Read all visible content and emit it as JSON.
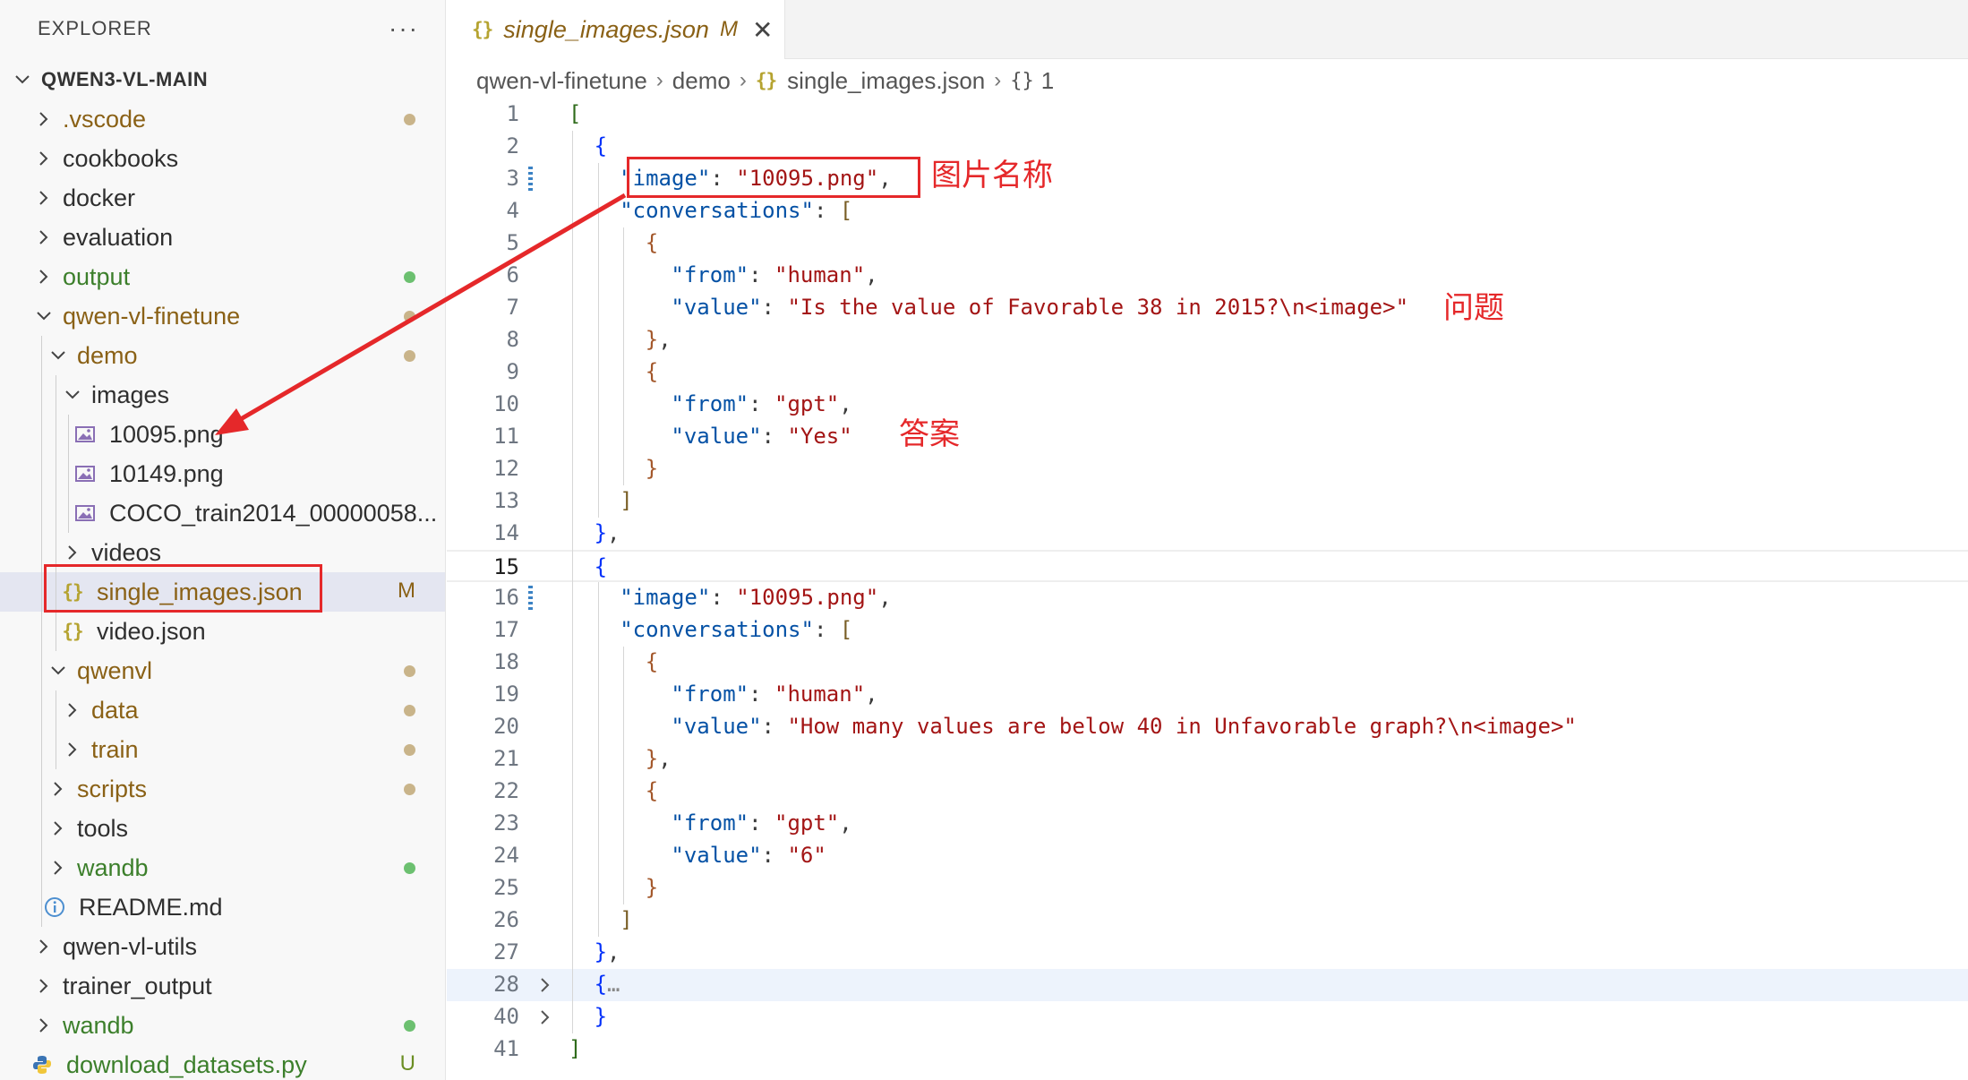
{
  "sidebar": {
    "title": "EXPLORER",
    "more": "···",
    "root": "QWEN3-VL-MAIN",
    "items": [
      {
        "label": ".vscode",
        "status": "dot"
      },
      {
        "label": "cookbooks"
      },
      {
        "label": "docker"
      },
      {
        "label": "evaluation"
      },
      {
        "label": "output",
        "status": "dot"
      },
      {
        "label": "qwen-vl-finetune",
        "status": "dot"
      },
      {
        "label": "demo",
        "status": "dot"
      },
      {
        "label": "images"
      },
      {
        "label": "10095.png"
      },
      {
        "label": "10149.png"
      },
      {
        "label": "COCO_train2014_00000058..."
      },
      {
        "label": "videos"
      },
      {
        "label": "single_images.json",
        "badge": "M"
      },
      {
        "label": "video.json"
      },
      {
        "label": "qwenvl",
        "status": "dot"
      },
      {
        "label": "data",
        "status": "dot"
      },
      {
        "label": "train",
        "status": "dot"
      },
      {
        "label": "scripts",
        "status": "dot"
      },
      {
        "label": "tools"
      },
      {
        "label": "wandb",
        "status": "dot"
      },
      {
        "label": "README.md"
      },
      {
        "label": "qwen-vl-utils"
      },
      {
        "label": "trainer_output"
      },
      {
        "label": "wandb",
        "status": "dot"
      },
      {
        "label": "download_datasets.py",
        "badge": "U"
      }
    ]
  },
  "tab": {
    "icon": "{}",
    "label": "single_images.json",
    "modified": "M",
    "close": "✕"
  },
  "breadcrumb": {
    "parts": [
      "qwen-vl-finetune",
      "demo",
      "single_images.json",
      "1"
    ],
    "json_icon": "{}",
    "object_icon": "{}"
  },
  "editor": {
    "line_numbers": [
      "1",
      "2",
      "3",
      "4",
      "5",
      "6",
      "7",
      "8",
      "9",
      "10",
      "11",
      "12",
      "13",
      "14",
      "15",
      "16",
      "17",
      "18",
      "19",
      "20",
      "21",
      "22",
      "23",
      "24",
      "25",
      "26",
      "27",
      "28",
      "40",
      "41"
    ],
    "current_line": "15",
    "lines": [
      [
        [
          "b1",
          "["
        ]
      ],
      [
        [
          "b2",
          "{"
        ]
      ],
      [
        [
          "key",
          "\"image\""
        ],
        [
          "punc",
          ": "
        ],
        [
          "str",
          "\"10095.png\""
        ],
        [
          "punc",
          ","
        ]
      ],
      [
        [
          "key",
          "\"conversations\""
        ],
        [
          "punc",
          ": "
        ],
        [
          "b3",
          "["
        ]
      ],
      [
        [
          "b4",
          "{"
        ]
      ],
      [
        [
          "key",
          "\"from\""
        ],
        [
          "punc",
          ": "
        ],
        [
          "str",
          "\"human\""
        ],
        [
          "punc",
          ","
        ]
      ],
      [
        [
          "key",
          "\"value\""
        ],
        [
          "punc",
          ": "
        ],
        [
          "str",
          "\"Is the value of Favorable 38 in 2015?\\n<image>\""
        ]
      ],
      [
        [
          "b4",
          "}"
        ],
        [
          "punc",
          ","
        ]
      ],
      [
        [
          "b4",
          "{"
        ]
      ],
      [
        [
          "key",
          "\"from\""
        ],
        [
          "punc",
          ": "
        ],
        [
          "str",
          "\"gpt\""
        ],
        [
          "punc",
          ","
        ]
      ],
      [
        [
          "key",
          "\"value\""
        ],
        [
          "punc",
          ": "
        ],
        [
          "str",
          "\"Yes\""
        ]
      ],
      [
        [
          "b4",
          "}"
        ]
      ],
      [
        [
          "b3",
          "]"
        ]
      ],
      [
        [
          "b2",
          "}"
        ],
        [
          "punc",
          ","
        ]
      ],
      [
        [
          "b2",
          "{"
        ]
      ],
      [
        [
          "key",
          "\"image\""
        ],
        [
          "punc",
          ": "
        ],
        [
          "str",
          "\"10095.png\""
        ],
        [
          "punc",
          ","
        ]
      ],
      [
        [
          "key",
          "\"conversations\""
        ],
        [
          "punc",
          ": "
        ],
        [
          "b3",
          "["
        ]
      ],
      [
        [
          "b4",
          "{"
        ]
      ],
      [
        [
          "key",
          "\"from\""
        ],
        [
          "punc",
          ": "
        ],
        [
          "str",
          "\"human\""
        ],
        [
          "punc",
          ","
        ]
      ],
      [
        [
          "key",
          "\"value\""
        ],
        [
          "punc",
          ": "
        ],
        [
          "str",
          "\"How many values are below 40 in Unfavorable graph?\\n<image>\""
        ]
      ],
      [
        [
          "b4",
          "}"
        ],
        [
          "punc",
          ","
        ]
      ],
      [
        [
          "b4",
          "{"
        ]
      ],
      [
        [
          "key",
          "\"from\""
        ],
        [
          "punc",
          ": "
        ],
        [
          "str",
          "\"gpt\""
        ],
        [
          "punc",
          ","
        ]
      ],
      [
        [
          "key",
          "\"value\""
        ],
        [
          "punc",
          ": "
        ],
        [
          "str",
          "\"6\""
        ]
      ],
      [
        [
          "b4",
          "}"
        ]
      ],
      [
        [
          "b3",
          "]"
        ]
      ],
      [
        [
          "b2",
          "}"
        ],
        [
          "punc",
          ","
        ]
      ],
      [
        [
          "b2",
          "{"
        ],
        [
          "fold",
          "…"
        ]
      ],
      [
        [
          "b2",
          "}"
        ]
      ],
      [
        [
          "b1",
          "]"
        ]
      ]
    ]
  },
  "annotations": {
    "image_name": "图片名称",
    "question": "问题",
    "answer": "答案"
  },
  "colors": {
    "annotation": "#e5282a",
    "modified_dot": "#c9b48a",
    "git_dot": "#6cc070",
    "untracked_badge": "#6b8e23"
  }
}
